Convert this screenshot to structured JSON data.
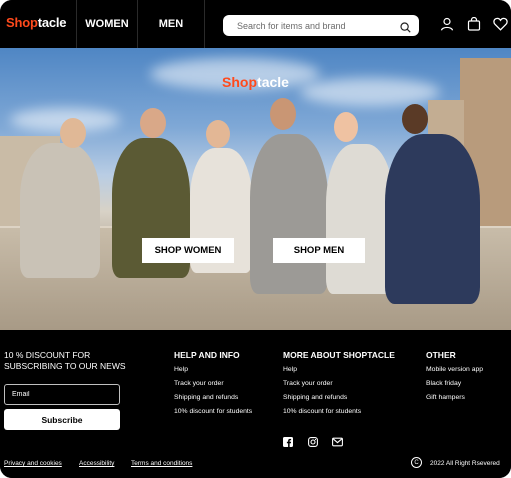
{
  "brand": {
    "part1": "Shop",
    "part2": "tacle"
  },
  "header": {
    "nav": [
      {
        "label": "WOMEN"
      },
      {
        "label": "MEN"
      }
    ],
    "search": {
      "placeholder": "Search for items and brand"
    },
    "icons": [
      "search-icon",
      "user-icon",
      "bag-icon",
      "heart-icon"
    ]
  },
  "hero": {
    "shop_women_label": "SHOP WOMEN",
    "shop_men_label": "SHOP MEN"
  },
  "footer": {
    "newsletter": {
      "heading_line1": "10 % DISCOUNT FOR",
      "heading_line2": "SUBSCRIBING TO OUR NEWS",
      "email_placeholder": "Email",
      "subscribe_label": "Subscribe"
    },
    "columns": [
      {
        "heading": "HELP AND INFO",
        "links": [
          "Help",
          "Track your order",
          "Shipping and refunds",
          "10% discount for students"
        ]
      },
      {
        "heading": "MORE ABOUT SHOPTACLE",
        "links": [
          "Help",
          "Track your order",
          "Shipping and refunds",
          "10% discount for students"
        ]
      },
      {
        "heading": "OTHER",
        "links": [
          "Mobile version app",
          "Black friday",
          "Gift hampers"
        ]
      }
    ],
    "social": [
      "facebook-icon",
      "instagram-icon",
      "mail-icon"
    ],
    "bottom_links": [
      "Privacy and cookies",
      "Accessibility",
      "Terms and conditions"
    ],
    "copyright_symbol": "C",
    "copyright": "2022 All Right Rsevered"
  },
  "colors": {
    "accent": "#ff4a1c",
    "background": "#000000",
    "text": "#ffffff"
  }
}
